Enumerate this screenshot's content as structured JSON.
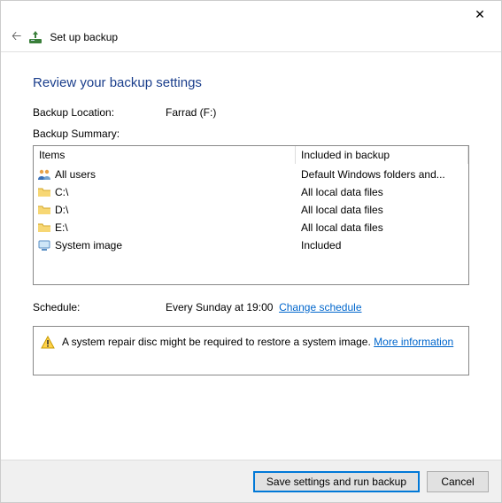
{
  "titlebar": {
    "close_glyph": "✕"
  },
  "nav": {
    "back_glyph": "🡠",
    "title": "Set up backup"
  },
  "heading": "Review your backup settings",
  "location": {
    "label": "Backup Location:",
    "value": "Farrad (F:)"
  },
  "summary_label": "Backup Summary:",
  "columns": {
    "c1": "Items",
    "c2": "Included in backup"
  },
  "items": [
    {
      "icon": "users",
      "name": "All users",
      "included": "Default Windows folders and..."
    },
    {
      "icon": "folder",
      "name": "C:\\",
      "included": "All local data files"
    },
    {
      "icon": "folder",
      "name": "D:\\",
      "included": "All local data files"
    },
    {
      "icon": "folder",
      "name": "E:\\",
      "included": "All local data files"
    },
    {
      "icon": "sysimage",
      "name": "System image",
      "included": "Included"
    }
  ],
  "schedule": {
    "label": "Schedule:",
    "value": "Every Sunday at 19:00",
    "change_link": "Change schedule"
  },
  "notice": {
    "text": "A system repair disc might be required to restore a system image. ",
    "link": "More information"
  },
  "buttons": {
    "primary": "Save settings and run backup",
    "cancel": "Cancel"
  }
}
